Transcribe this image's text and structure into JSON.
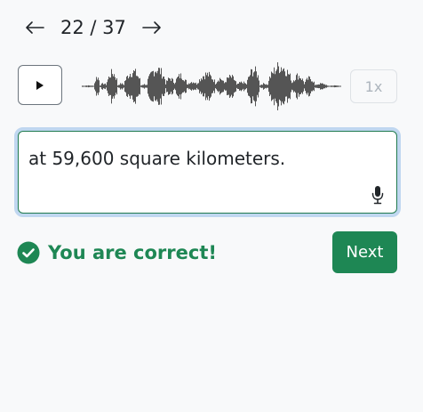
{
  "pager": {
    "current": "22",
    "total": "37",
    "text": "22 / 37"
  },
  "player": {
    "speed_label": "1x"
  },
  "answer": {
    "value": "at 59,600 square kilometers."
  },
  "result": {
    "message": "You are correct!"
  },
  "actions": {
    "next_label": "Next"
  },
  "colors": {
    "success": "#1e8754",
    "focus_ring": "#c0d7f0",
    "waveform": "#555555"
  },
  "icons": {
    "prev": "arrow-left-icon",
    "next": "arrow-right-icon",
    "play": "play-icon",
    "mic": "microphone-icon",
    "check": "check-circle-icon"
  }
}
